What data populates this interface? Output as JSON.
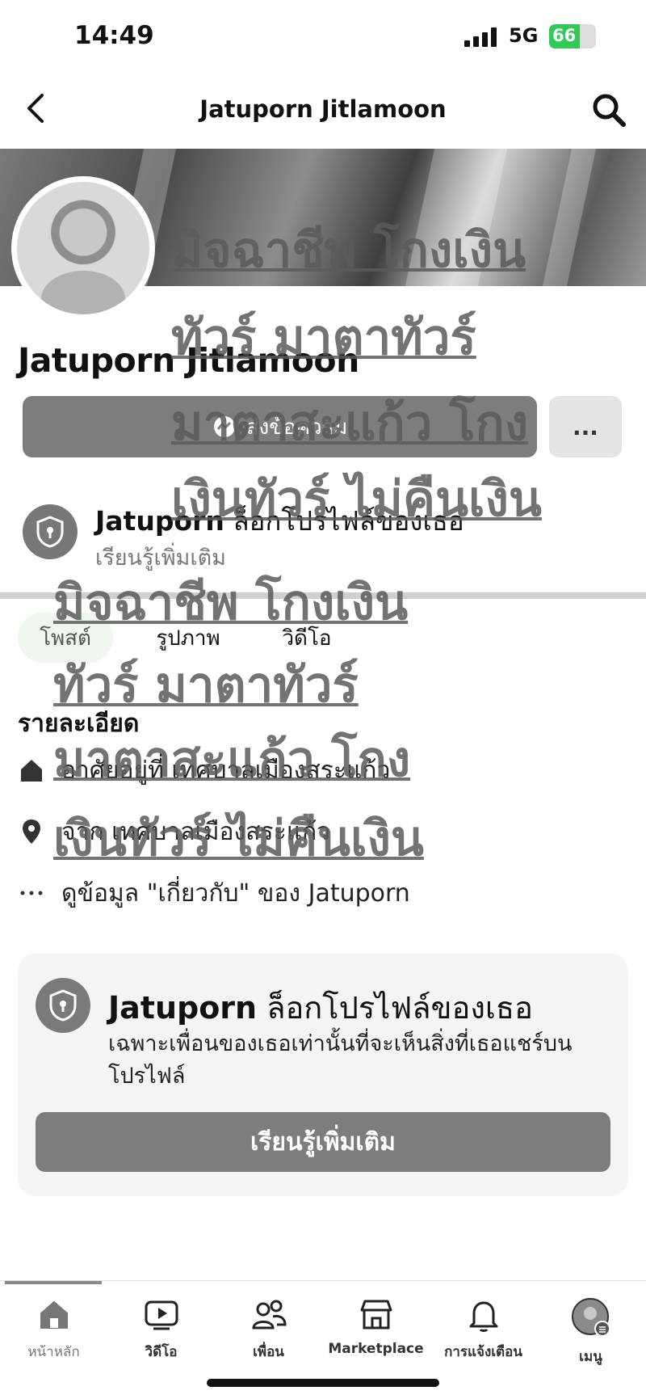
{
  "status": {
    "time": "14:49",
    "network": "5G",
    "battery": "66",
    "battery_level": 0.66
  },
  "header": {
    "title": "Jatuporn Jitlamoon"
  },
  "profile": {
    "name": "Jatuporn Jitlamoon",
    "message_button": "ส่งข้อความ",
    "more_button": "...",
    "lock_notice_name": "Jatuporn",
    "lock_notice_text": " ล็อกโปรไฟล์ของเธอ",
    "lock_notice_link": "เรียนรู้เพิ่มเติม"
  },
  "tabs": [
    {
      "label": "โพสต์",
      "active": true
    },
    {
      "label": "รูปภาพ",
      "active": false
    },
    {
      "label": "วิดีโอ",
      "active": false
    }
  ],
  "details": {
    "title": "รายละเอียด",
    "items": [
      {
        "icon": "home-icon",
        "text": "อาศัยอยู่ที่ เทศบาลเมืองสระแก้ว"
      },
      {
        "icon": "location-pin-icon",
        "text": "จาก เทศบาลเมืองสระแก้ว"
      },
      {
        "icon": "more-dots-icon",
        "text": "ดูข้อมูล \"เกี่ยวกับ\" ของ Jatuporn"
      }
    ]
  },
  "watermark": {
    "lines": [
      "มิจฉาชีพ โกงเงิน",
      "ทัวร์ มาตาทัวร์",
      "มาตาสะแก้ว โกง",
      "เงินทัวร์ ไม่คืนเงิน"
    ]
  },
  "locked_card": {
    "name": "Jatuporn",
    "title_rest": " ล็อกโปรไฟล์ของเธอ",
    "description": "เฉพาะเพื่อนของเธอเท่านั้นที่จะเห็นสิ่งที่เธอแชร์บนโปรไฟล์",
    "button": "เรียนรู้เพิ่มเติม"
  },
  "bottom_nav": [
    {
      "label": "หน้าหลัก",
      "icon": "home-icon",
      "active": true
    },
    {
      "label": "วิดีโอ",
      "icon": "video-icon",
      "active": false
    },
    {
      "label": "เพื่อน",
      "icon": "friends-icon",
      "active": false
    },
    {
      "label": "Marketplace",
      "icon": "marketplace-icon",
      "active": false
    },
    {
      "label": "การแจ้งเตือน",
      "icon": "bell-icon",
      "active": false
    },
    {
      "label": "เมนู",
      "icon": "menu-avatar-icon",
      "active": false
    }
  ],
  "colors": {
    "battery": "#34c759",
    "button_gray": "#7d7d7d",
    "tab_active_bg": "#eef6ee"
  }
}
